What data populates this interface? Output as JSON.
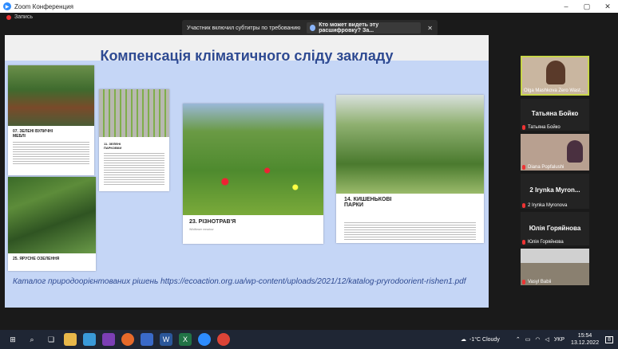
{
  "window": {
    "title": "Zoom Конференция",
    "min": "–",
    "max": "▢",
    "close": "✕"
  },
  "recording": {
    "label": "Запись"
  },
  "caption_banner": {
    "message": "Участник включил субтитры по требованию",
    "who_can_see": "Кто может видеть эту расшифровку? За...",
    "close": "✕"
  },
  "slide": {
    "heading": "Компенсація кліматичного сліду закладу",
    "cards": [
      {
        "label": "07. ЗЕЛЕНІ ВУЛИЧНІ МЕБЛІ"
      },
      {
        "label": "11. ЗЕЛЕНІ ПАРКОВКИ"
      },
      {
        "label": "23. РІЗНОТРАВ'Я",
        "sub": "Wildflower meadow"
      },
      {
        "label": "14. КИШЕНЬКОВІ ПАРКИ"
      },
      {
        "label": "25. ЯРУСНЕ ОЗЕЛЕННЯ"
      }
    ],
    "catalog_text": "Каталог природоорієнтованих рішень",
    "catalog_url": "https://ecoaction.org.ua/wp-content/uploads/2021/12/katalog-pryrodoorient-rishen1.pdf"
  },
  "participants": [
    {
      "small": "Olga Mashkova Zero Wast...",
      "big": "",
      "type": "video",
      "active": true
    },
    {
      "small": "Татьяна Бойко",
      "big": "Татьяна Бойко",
      "type": "name"
    },
    {
      "small": "Diana Popfalushi",
      "big": "",
      "type": "video"
    },
    {
      "small": "2 Irynka Myronova",
      "big": "2 Irynka Myron...",
      "type": "name"
    },
    {
      "small": "Юлія Горяйнова",
      "big": "Юлія Горяйнова",
      "type": "name"
    },
    {
      "small": "Vasyl Babii",
      "big": "",
      "type": "video"
    }
  ],
  "taskbar": {
    "weather": "-1°C Cloudy",
    "lang": "УКР",
    "time": "15:54",
    "date": "13.12.2022",
    "notif": "8"
  },
  "colors": {
    "heading": "#2e4a92",
    "slide_bg": "#c5d6f6",
    "active_border": "#c8d64a"
  }
}
